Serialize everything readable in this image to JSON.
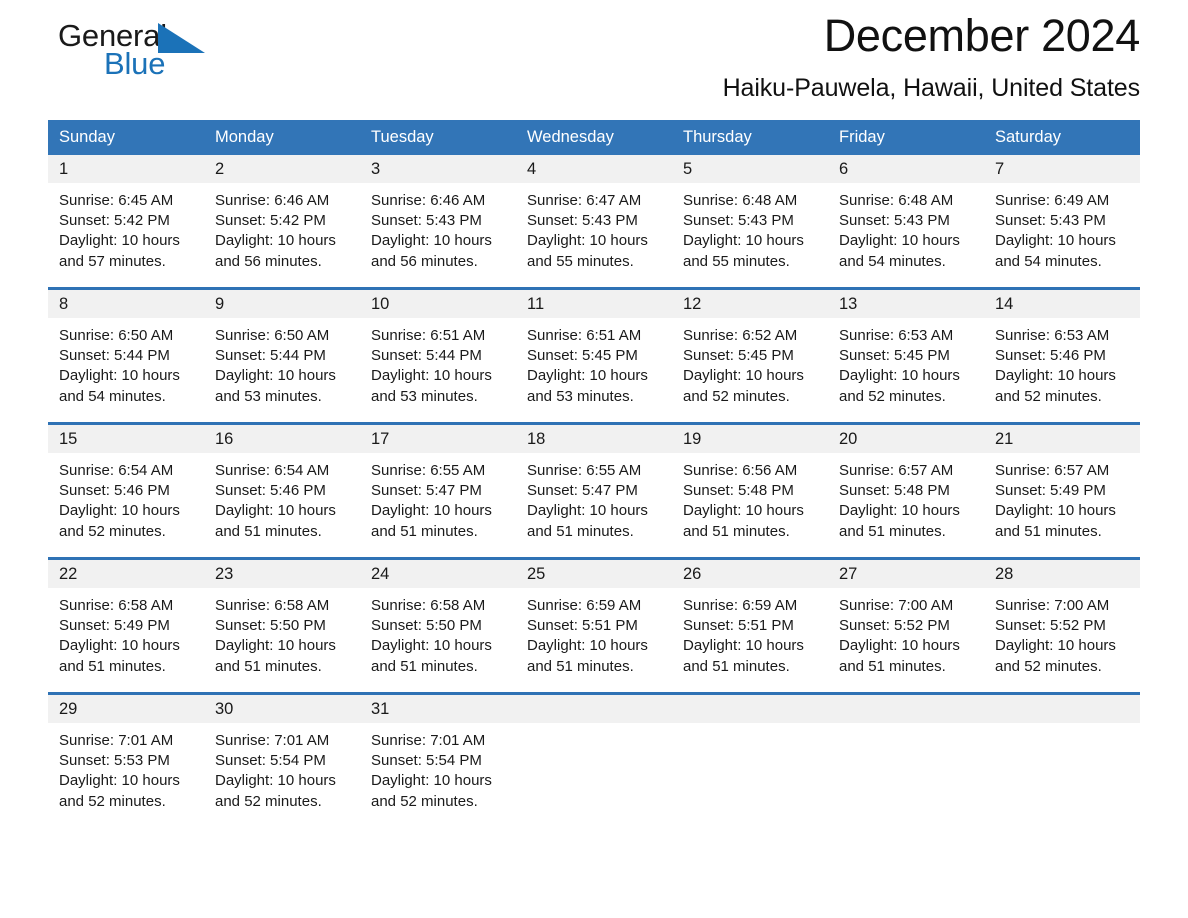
{
  "brand": {
    "name_part1": "General",
    "name_part2": "Blue",
    "flag_icon": "triangle-flag-icon",
    "accent_color": "#1b72b8"
  },
  "header": {
    "month_title": "December 2024",
    "location": "Haiku-Pauwela, Hawaii, United States"
  },
  "theme": {
    "header_bg": "#3275b7",
    "separator": "#2f72b5",
    "daynum_bg": "#f1f1f1"
  },
  "weekdays": [
    "Sunday",
    "Monday",
    "Tuesday",
    "Wednesday",
    "Thursday",
    "Friday",
    "Saturday"
  ],
  "weeks": [
    {
      "days": [
        {
          "num": "1",
          "detail": "Sunrise: 6:45 AM\nSunset: 5:42 PM\nDaylight: 10 hours\nand 57 minutes."
        },
        {
          "num": "2",
          "detail": "Sunrise: 6:46 AM\nSunset: 5:42 PM\nDaylight: 10 hours\nand 56 minutes."
        },
        {
          "num": "3",
          "detail": "Sunrise: 6:46 AM\nSunset: 5:43 PM\nDaylight: 10 hours\nand 56 minutes."
        },
        {
          "num": "4",
          "detail": "Sunrise: 6:47 AM\nSunset: 5:43 PM\nDaylight: 10 hours\nand 55 minutes."
        },
        {
          "num": "5",
          "detail": "Sunrise: 6:48 AM\nSunset: 5:43 PM\nDaylight: 10 hours\nand 55 minutes."
        },
        {
          "num": "6",
          "detail": "Sunrise: 6:48 AM\nSunset: 5:43 PM\nDaylight: 10 hours\nand 54 minutes."
        },
        {
          "num": "7",
          "detail": "Sunrise: 6:49 AM\nSunset: 5:43 PM\nDaylight: 10 hours\nand 54 minutes."
        }
      ]
    },
    {
      "days": [
        {
          "num": "8",
          "detail": "Sunrise: 6:50 AM\nSunset: 5:44 PM\nDaylight: 10 hours\nand 54 minutes."
        },
        {
          "num": "9",
          "detail": "Sunrise: 6:50 AM\nSunset: 5:44 PM\nDaylight: 10 hours\nand 53 minutes."
        },
        {
          "num": "10",
          "detail": "Sunrise: 6:51 AM\nSunset: 5:44 PM\nDaylight: 10 hours\nand 53 minutes."
        },
        {
          "num": "11",
          "detail": "Sunrise: 6:51 AM\nSunset: 5:45 PM\nDaylight: 10 hours\nand 53 minutes."
        },
        {
          "num": "12",
          "detail": "Sunrise: 6:52 AM\nSunset: 5:45 PM\nDaylight: 10 hours\nand 52 minutes."
        },
        {
          "num": "13",
          "detail": "Sunrise: 6:53 AM\nSunset: 5:45 PM\nDaylight: 10 hours\nand 52 minutes."
        },
        {
          "num": "14",
          "detail": "Sunrise: 6:53 AM\nSunset: 5:46 PM\nDaylight: 10 hours\nand 52 minutes."
        }
      ]
    },
    {
      "days": [
        {
          "num": "15",
          "detail": "Sunrise: 6:54 AM\nSunset: 5:46 PM\nDaylight: 10 hours\nand 52 minutes."
        },
        {
          "num": "16",
          "detail": "Sunrise: 6:54 AM\nSunset: 5:46 PM\nDaylight: 10 hours\nand 51 minutes."
        },
        {
          "num": "17",
          "detail": "Sunrise: 6:55 AM\nSunset: 5:47 PM\nDaylight: 10 hours\nand 51 minutes."
        },
        {
          "num": "18",
          "detail": "Sunrise: 6:55 AM\nSunset: 5:47 PM\nDaylight: 10 hours\nand 51 minutes."
        },
        {
          "num": "19",
          "detail": "Sunrise: 6:56 AM\nSunset: 5:48 PM\nDaylight: 10 hours\nand 51 minutes."
        },
        {
          "num": "20",
          "detail": "Sunrise: 6:57 AM\nSunset: 5:48 PM\nDaylight: 10 hours\nand 51 minutes."
        },
        {
          "num": "21",
          "detail": "Sunrise: 6:57 AM\nSunset: 5:49 PM\nDaylight: 10 hours\nand 51 minutes."
        }
      ]
    },
    {
      "days": [
        {
          "num": "22",
          "detail": "Sunrise: 6:58 AM\nSunset: 5:49 PM\nDaylight: 10 hours\nand 51 minutes."
        },
        {
          "num": "23",
          "detail": "Sunrise: 6:58 AM\nSunset: 5:50 PM\nDaylight: 10 hours\nand 51 minutes."
        },
        {
          "num": "24",
          "detail": "Sunrise: 6:58 AM\nSunset: 5:50 PM\nDaylight: 10 hours\nand 51 minutes."
        },
        {
          "num": "25",
          "detail": "Sunrise: 6:59 AM\nSunset: 5:51 PM\nDaylight: 10 hours\nand 51 minutes."
        },
        {
          "num": "26",
          "detail": "Sunrise: 6:59 AM\nSunset: 5:51 PM\nDaylight: 10 hours\nand 51 minutes."
        },
        {
          "num": "27",
          "detail": "Sunrise: 7:00 AM\nSunset: 5:52 PM\nDaylight: 10 hours\nand 51 minutes."
        },
        {
          "num": "28",
          "detail": "Sunrise: 7:00 AM\nSunset: 5:52 PM\nDaylight: 10 hours\nand 52 minutes."
        }
      ]
    },
    {
      "days": [
        {
          "num": "29",
          "detail": "Sunrise: 7:01 AM\nSunset: 5:53 PM\nDaylight: 10 hours\nand 52 minutes."
        },
        {
          "num": "30",
          "detail": "Sunrise: 7:01 AM\nSunset: 5:54 PM\nDaylight: 10 hours\nand 52 minutes."
        },
        {
          "num": "31",
          "detail": "Sunrise: 7:01 AM\nSunset: 5:54 PM\nDaylight: 10 hours\nand 52 minutes."
        },
        {
          "num": "",
          "detail": ""
        },
        {
          "num": "",
          "detail": ""
        },
        {
          "num": "",
          "detail": ""
        },
        {
          "num": "",
          "detail": ""
        }
      ]
    }
  ]
}
